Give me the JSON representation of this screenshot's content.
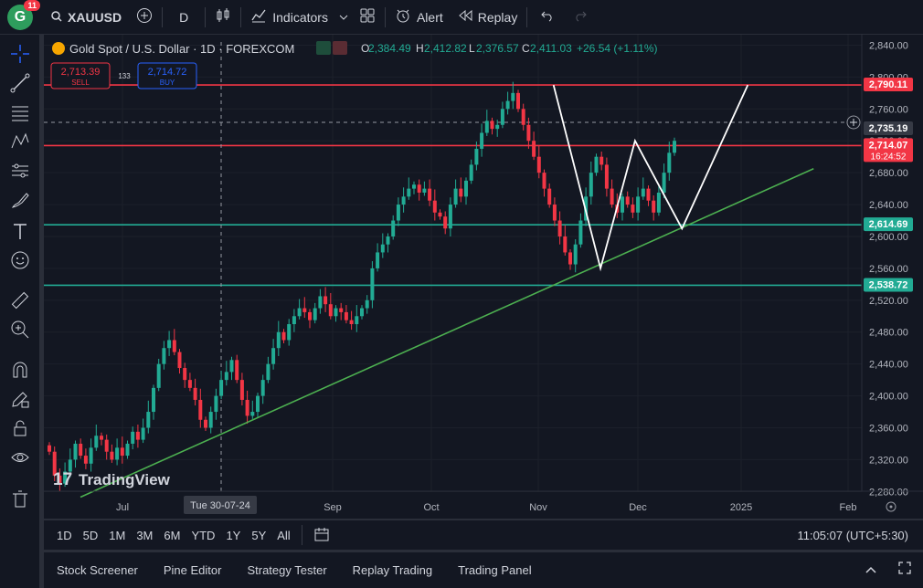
{
  "topbar": {
    "avatar_letter": "G",
    "notification_count": "11",
    "symbol": "XAUUSD",
    "interval": "D",
    "indicators_label": "Indicators",
    "alert_label": "Alert",
    "replay_label": "Replay"
  },
  "legend": {
    "title": "Gold Spot / U.S. Dollar · 1D · FOREXCOM",
    "o_label": "O",
    "o_value": "2,384.49",
    "h_label": "H",
    "h_value": "2,412.82",
    "l_label": "L",
    "l_value": "2,376.57",
    "c_label": "C",
    "c_value": "2,411.03",
    "change": "+26.54 (+1.11%)"
  },
  "trade": {
    "sell_price": "2,713.39",
    "sell_label": "SELL",
    "spread": "133",
    "buy_price": "2,714.72",
    "buy_label": "BUY"
  },
  "price_axis": {
    "ticks": [
      "2,840.00",
      "2,800.00",
      "2,760.00",
      "2,720.00",
      "2,680.00",
      "2,640.00",
      "2,600.00",
      "2,560.00",
      "2,520.00",
      "2,480.00",
      "2,440.00",
      "2,400.00",
      "2,360.00",
      "2,320.00",
      "2,280.00",
      "2,240.00"
    ],
    "labels": [
      {
        "value": 2790.11,
        "text": "2,790.11",
        "color": "#f23645"
      },
      {
        "value": 2735.19,
        "text": "2,735.19",
        "color": "#363a45"
      },
      {
        "value": 2714.07,
        "text": "2,714.07",
        "sub": "16:24:52",
        "color": "#f23645"
      },
      {
        "value": 2614.69,
        "text": "2,614.69",
        "color": "#22ab94"
      },
      {
        "value": 2538.72,
        "text": "2,538.72",
        "color": "#22ab94"
      }
    ]
  },
  "time_axis": {
    "ticks": [
      "Jul",
      "Sep",
      "Oct",
      "Nov",
      "Dec",
      "2025",
      "Feb"
    ],
    "crosshair_label": "Tue 30-07-24"
  },
  "watermark": "TradingView",
  "ranges": [
    "1D",
    "5D",
    "1M",
    "3M",
    "6M",
    "YTD",
    "1Y",
    "5Y",
    "All"
  ],
  "clock": "11:05:07 (UTC+5:30)",
  "panels": [
    "Stock Screener",
    "Pine Editor",
    "Strategy Tester",
    "Replay Trading",
    "Trading Panel"
  ],
  "chart_data": {
    "type": "candlestick",
    "ylim": [
      2230,
      2860
    ],
    "horizontal_levels": [
      {
        "value": 2790.11,
        "color": "#f23645"
      },
      {
        "value": 2714.07,
        "color": "#f23645"
      },
      {
        "value": 2614.69,
        "color": "#22ab94"
      },
      {
        "value": 2538.72,
        "color": "#22ab94"
      }
    ],
    "trend_line": [
      [
        "2024-06-01",
        2273
      ],
      [
        "2025-01-21",
        2685
      ]
    ],
    "zigzag": [
      [
        "2024-10-30",
        2790
      ],
      [
        "2024-11-14",
        2560
      ],
      [
        "2024-11-25",
        2720
      ],
      [
        "2024-12-10",
        2610
      ],
      [
        "2024-12-31",
        2790
      ]
    ],
    "closes": [
      2330,
      2300,
      2290,
      2305,
      2320,
      2340,
      2325,
      2315,
      2335,
      2350,
      2345,
      2330,
      2320,
      2335,
      2325,
      2340,
      2355,
      2345,
      2360,
      2380,
      2410,
      2440,
      2460,
      2470,
      2455,
      2435,
      2420,
      2410,
      2395,
      2370,
      2360,
      2380,
      2400,
      2420,
      2430,
      2445,
      2420,
      2395,
      2375,
      2380,
      2400,
      2420,
      2440,
      2460,
      2480,
      2470,
      2490,
      2500,
      2510,
      2505,
      2495,
      2510,
      2525,
      2515,
      2500,
      2510,
      2505,
      2495,
      2490,
      2500,
      2510,
      2520,
      2560,
      2580,
      2590,
      2600,
      2620,
      2640,
      2650,
      2660,
      2665,
      2655,
      2660,
      2645,
      2630,
      2625,
      2610,
      2640,
      2660,
      2650,
      2670,
      2690,
      2710,
      2730,
      2745,
      2735,
      2740,
      2760,
      2770,
      2780,
      2760,
      2740,
      2720,
      2700,
      2680,
      2660,
      2640,
      2620,
      2600,
      2580,
      2565,
      2590,
      2620,
      2650,
      2680,
      2700,
      2690,
      2660,
      2640,
      2630,
      2650,
      2640,
      2630,
      2650,
      2660,
      2645,
      2630,
      2655,
      2680,
      2705,
      2720
    ]
  }
}
